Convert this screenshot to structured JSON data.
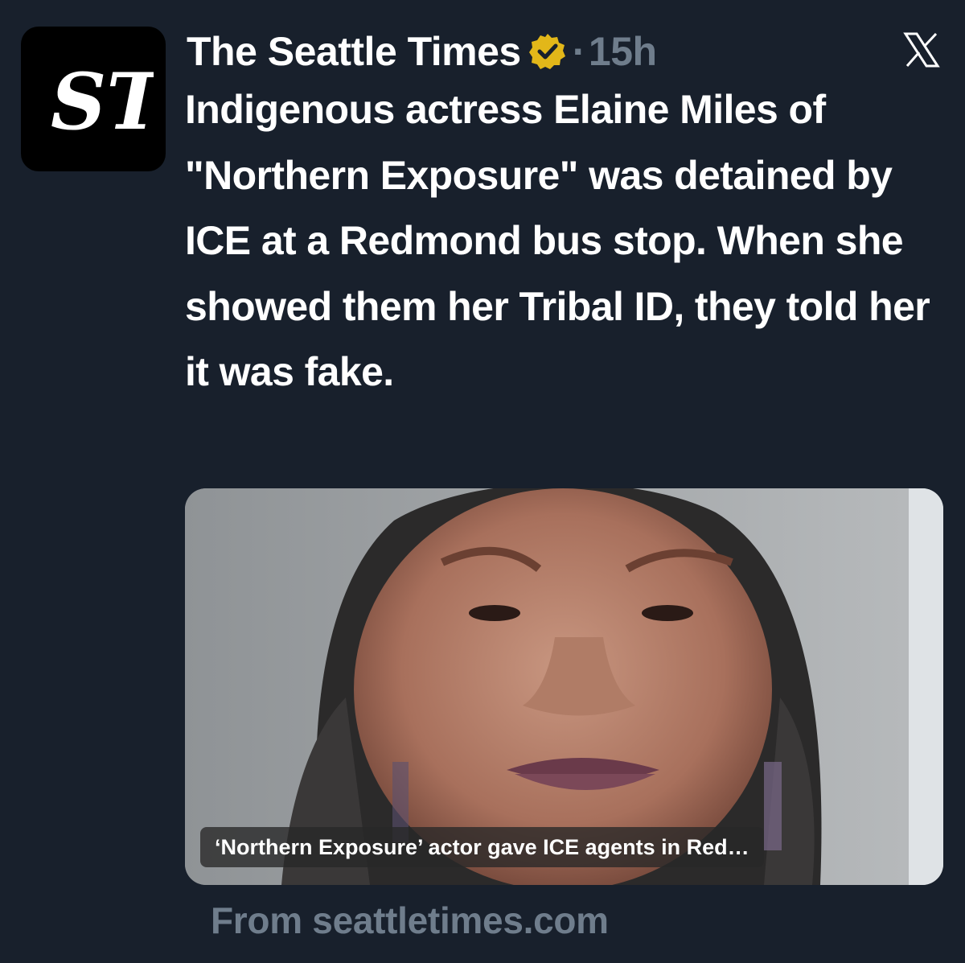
{
  "account": {
    "name": "The Seattle Times",
    "avatar_monogram": "ST",
    "verified_icon": "verified-gold-badge-icon",
    "separator": "·",
    "time": "15h"
  },
  "platform_icon": "x-logo-icon",
  "tweet": {
    "text": "Indigenous actress Elaine Miles of \"Northern Exposure\" was detained by ICE at a Redmond bus stop. When she showed them her Tribal ID, they told her it was fake."
  },
  "link_card": {
    "caption": "‘Northern Exposure’ actor gave ICE agents in Red…",
    "source": "From seattletimes.com"
  },
  "colors": {
    "background": "#18202c",
    "muted_text": "#6f7d8c",
    "verified_gold": "#e2b719"
  }
}
